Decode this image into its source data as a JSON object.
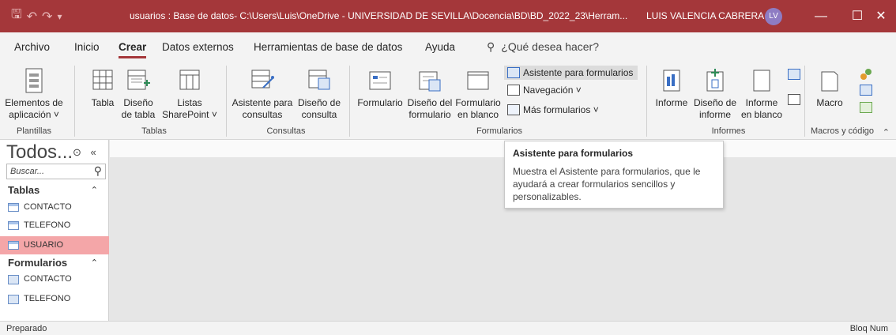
{
  "titlebar": {
    "title": "usuarios : Base de datos- C:\\Users\\Luis\\OneDrive - UNIVERSIDAD DE SEVILLA\\Docencia\\BD\\BD_2022_23\\Herram...",
    "user": "LUIS VALENCIA CABRERA",
    "avatar_initials": "LV",
    "accent": "#a4373a"
  },
  "menu": {
    "tabs": [
      "Archivo",
      "Inicio",
      "Crear",
      "Datos externos",
      "Herramientas de base de datos",
      "Ayuda"
    ],
    "active": "Crear",
    "search_placeholder": "¿Qué desea hacer?"
  },
  "ribbon": {
    "plantillas": {
      "label": "Plantillas",
      "app_parts_l1": "Elementos de",
      "app_parts_l2": "aplicación ˅"
    },
    "tablas": {
      "label": "Tablas",
      "tabla": "Tabla",
      "diseno_l1": "Diseño",
      "diseno_l2": "de tabla",
      "listas_l1": "Listas",
      "listas_l2": "SharePoint ˅"
    },
    "consultas": {
      "label": "Consultas",
      "asistente_l1": "Asistente para",
      "asistente_l2": "consultas",
      "diseno_l1": "Diseño de",
      "diseno_l2": "consulta"
    },
    "formularios": {
      "label": "Formularios",
      "formulario": "Formulario",
      "diseno_l1": "Diseño del",
      "diseno_l2": "formulario",
      "blanco_l1": "Formulario",
      "blanco_l2": "en blanco",
      "asistente": "Asistente para formularios",
      "navegacion": "Navegación ˅",
      "mas": "Más formularios ˅"
    },
    "informes": {
      "label": "Informes",
      "informe": "Informe",
      "diseno_l1": "Diseño de",
      "diseno_l2": "informe",
      "blanco_l1": "Informe",
      "blanco_l2": "en blanco"
    },
    "macros": {
      "label": "Macros y código",
      "macro": "Macro"
    }
  },
  "nav": {
    "header": "Todos...",
    "search_placeholder": "Buscar...",
    "sections": [
      {
        "title": "Tablas",
        "items": [
          "CONTACTO",
          "TELEFONO",
          "USUARIO"
        ]
      },
      {
        "title": "Formularios",
        "items": [
          "CONTACTO",
          "TELEFONO"
        ]
      }
    ],
    "selected_item": "USUARIO",
    "selected_color": "#f4a6a8"
  },
  "tooltip": {
    "title": "Asistente para formularios",
    "body": "Muestra el Asistente para formularios, que le ayudará a crear formularios sencillos y personalizables."
  },
  "status": {
    "left": "Preparado",
    "right": "Bloq Num"
  }
}
